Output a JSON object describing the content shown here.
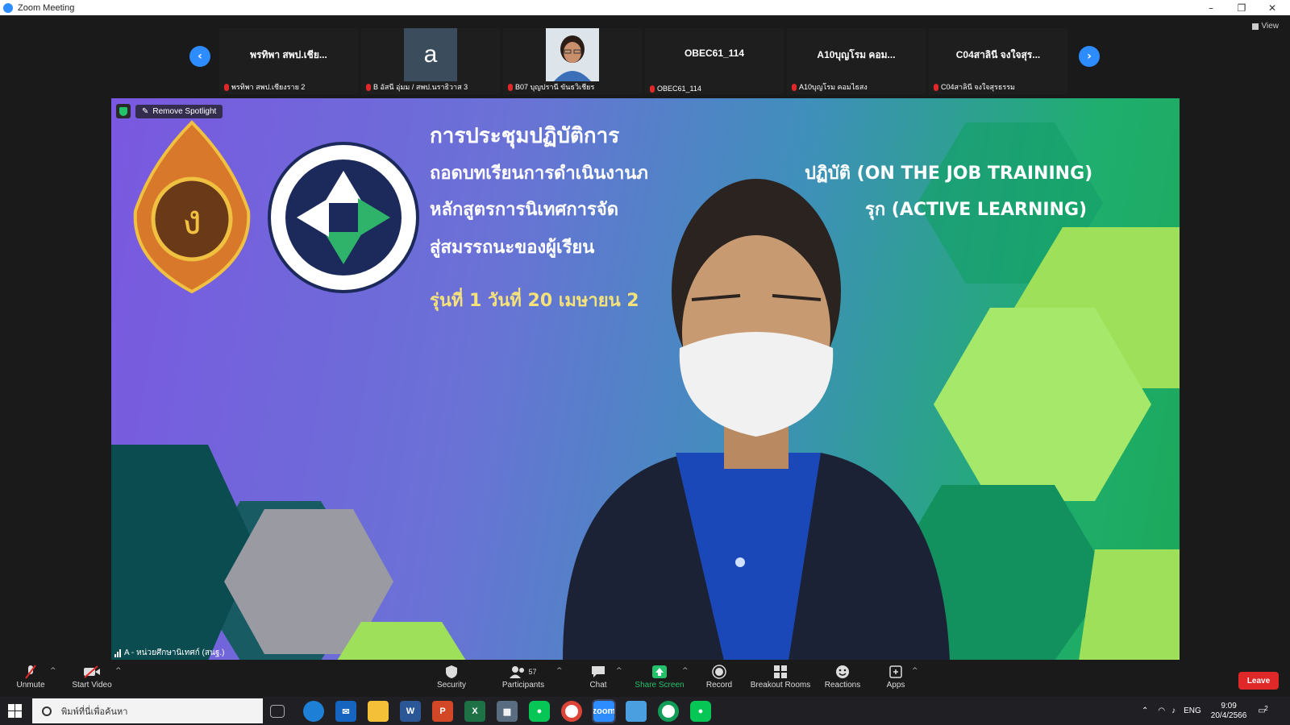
{
  "window": {
    "title": "Zoom Meeting",
    "controls": {
      "minimize": "–",
      "restore": "❐",
      "close": "✕"
    }
  },
  "view_button": {
    "label": "View"
  },
  "participant_strip": {
    "prev_icon": "chevron-left-icon",
    "next_icon": "chevron-right-icon",
    "tiles": [
      {
        "display": "พรทิพา สพป.เชีย...",
        "label": "พรทิพา สพป.เชียงราย 2",
        "muted": true,
        "kind": "name"
      },
      {
        "display": "a",
        "label": "B อัสนี อุ่มม / สพป.นราธิวาส 3",
        "muted": true,
        "kind": "letter"
      },
      {
        "display": "",
        "label": "B07 บุญปรานี ขันธวิเชียร",
        "muted": true,
        "kind": "photo"
      },
      {
        "display": "OBEC61_114",
        "label": "OBEC61_114",
        "muted": true,
        "kind": "name"
      },
      {
        "display": "A10บุญโรม คอม...",
        "label": "A10บุญโรม คอมไธสง",
        "muted": true,
        "kind": "name"
      },
      {
        "display": "C04สาลินี จงใจสุร...",
        "label": "C04สาลินี จงใจสุรธรรม",
        "muted": true,
        "kind": "name"
      }
    ]
  },
  "main_video": {
    "remove_spotlight": "Remove Spotlight",
    "speaker_name": "A - หน่วยศึกษานิเทศก์ (สนฐ.)",
    "slide": {
      "line1": "การประชุมปฏิบัติการ",
      "line2_left": "ถอดบทเรียนการดำเนินงานภ",
      "line2_right": "ปฏิบัติ (ON THE JOB TRAINING)",
      "line3_left": "หลักสูตรการนิเทศการจัด",
      "line3_right": "รุก (ACTIVE LEARNING)",
      "line4": "สู่สมรรถนะของผู้เรียน",
      "line5": "รุ่นที่ 1 วันที่ 20 เมษายน 2"
    }
  },
  "toolbar": {
    "unmute": "Unmute",
    "start_video": "Start Video",
    "security": "Security",
    "participants": "Participants",
    "participant_count": "57",
    "chat": "Chat",
    "share_screen": "Share Screen",
    "record": "Record",
    "breakout_rooms": "Breakout Rooms",
    "reactions": "Reactions",
    "apps": "Apps",
    "leave": "Leave",
    "caret": "^"
  },
  "taskbar": {
    "search_placeholder": "พิมพ์ที่นี่เพื่อค้นหา",
    "language": "ENG",
    "time": "9:09",
    "date": "20/4/2566",
    "notification_count": "2"
  },
  "colors": {
    "accent": "#2d8cff",
    "leave": "#e02828",
    "share": "#23c16b"
  }
}
